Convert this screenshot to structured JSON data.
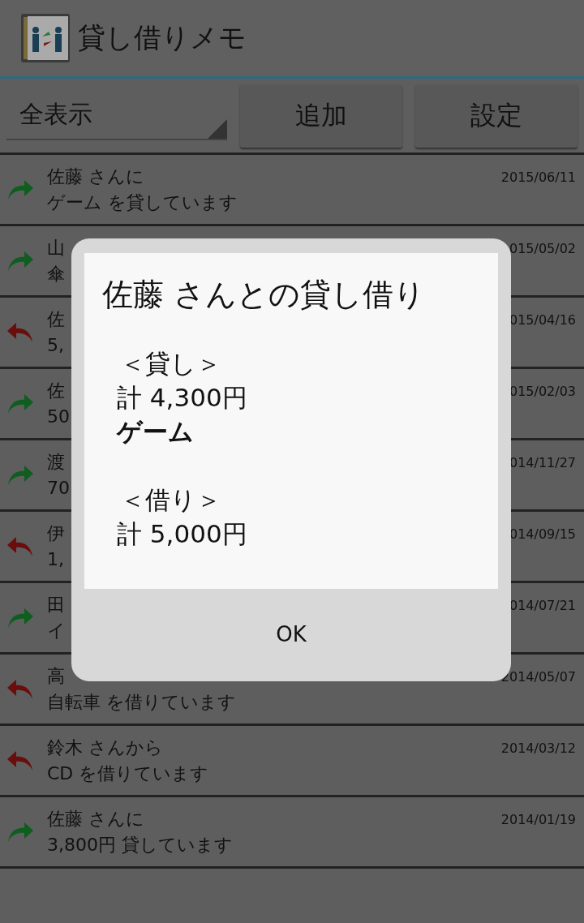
{
  "app_bar": {
    "title": "貸し借りメモ"
  },
  "toolbar": {
    "filter": {
      "value": "全表示"
    },
    "buttons": [
      "追加",
      "設定"
    ]
  },
  "rows": [
    {
      "kind": "lend",
      "line1": "佐藤 さんに",
      "line2": "ゲーム を貸しています",
      "date": "2015/06/11"
    },
    {
      "kind": "lend",
      "line1": "山",
      "line2": "傘",
      "date": "015/05/02"
    },
    {
      "kind": "borrow",
      "line1": "佐",
      "line2": "5,",
      "date": "015/04/16"
    },
    {
      "kind": "lend",
      "line1": "佐",
      "line2": "50",
      "date": "015/02/03"
    },
    {
      "kind": "lend",
      "line1": "渡",
      "line2": "70",
      "date": "014/11/27"
    },
    {
      "kind": "borrow",
      "line1": "伊",
      "line2": "1,",
      "date": "014/09/15"
    },
    {
      "kind": "lend",
      "line1": "田",
      "line2": "イ",
      "date": "014/07/21"
    },
    {
      "kind": "borrow",
      "line1": "高",
      "line2": "自転車 を借りています",
      "date": "2014/05/07"
    },
    {
      "kind": "borrow",
      "line1": "鈴木 さんから",
      "line2": "CD を借りています",
      "date": "2014/03/12"
    },
    {
      "kind": "lend",
      "line1": "佐藤 さんに",
      "line2": "3,800円 貸しています",
      "date": "2014/01/19"
    }
  ],
  "dialog": {
    "title": "佐藤 さんとの貸し借り",
    "lines": [
      {
        "kind": "heading",
        "text": "＜貸し＞"
      },
      {
        "kind": "line",
        "text": "計 4,300円"
      },
      {
        "kind": "item",
        "text": "ゲーム"
      },
      {
        "kind": "gap"
      },
      {
        "kind": "heading",
        "text": "＜借り＞"
      },
      {
        "kind": "line",
        "text": "計 5,000円"
      }
    ],
    "button": "OK"
  }
}
